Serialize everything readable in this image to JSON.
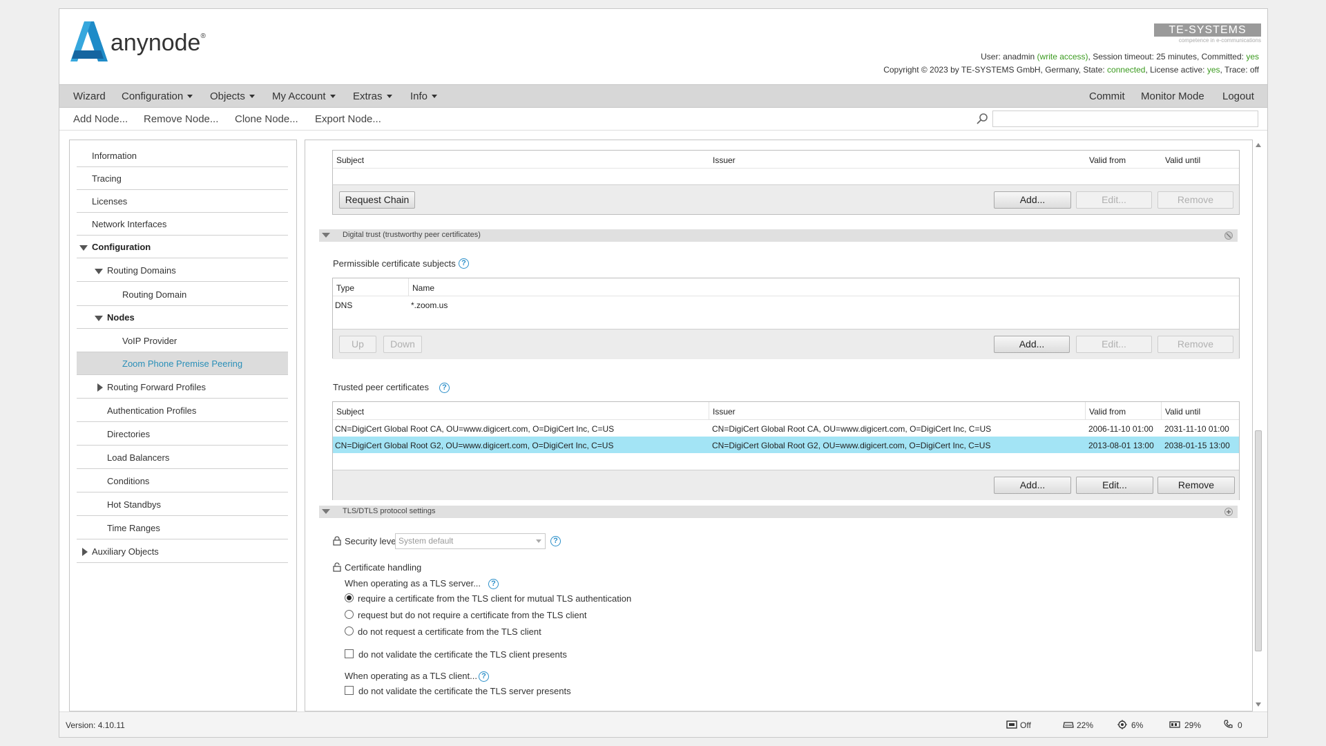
{
  "app": {
    "name": "anynode",
    "trademark": "®",
    "vendor": "TE-SYSTEMS",
    "vendor_tagline": "competence in e-communications"
  },
  "header": {
    "line1": {
      "user_prefix": "User: ",
      "user": "anadmin",
      "access": "(write access)",
      "session": ", Session timeout: 25 minutes, Committed: ",
      "committed": "yes"
    },
    "line2": {
      "copyright": "Copyright © 2023 by TE-SYSTEMS GmbH, Germany, State: ",
      "state": "connected",
      "license_prefix": ", License active: ",
      "license": "yes",
      "trace": ", Trace: off"
    }
  },
  "menu": {
    "left": [
      "Wizard",
      "Configuration",
      "Objects",
      "My Account",
      "Extras",
      "Info"
    ],
    "right": [
      "Commit",
      "Monitor Mode",
      "Logout"
    ]
  },
  "toolbar": {
    "actions": [
      "Add Node...",
      "Remove Node...",
      "Clone Node...",
      "Export Node..."
    ],
    "search_placeholder": ""
  },
  "sidebar": {
    "items": [
      {
        "label": "Information"
      },
      {
        "label": "Tracing"
      },
      {
        "label": "Licenses"
      },
      {
        "label": "Network Interfaces"
      },
      {
        "label": "Configuration"
      },
      {
        "label": "Routing Domains"
      },
      {
        "label": "Routing Domain"
      },
      {
        "label": "Nodes"
      },
      {
        "label": "VoIP Provider"
      },
      {
        "label": "Zoom Phone Premise Peering"
      },
      {
        "label": "Routing Forward Profiles"
      },
      {
        "label": "Authentication Profiles"
      },
      {
        "label": "Directories"
      },
      {
        "label": "Load Balancers"
      },
      {
        "label": "Conditions"
      },
      {
        "label": "Hot Standbys"
      },
      {
        "label": "Time Ranges"
      },
      {
        "label": "Auxiliary Objects"
      }
    ]
  },
  "chain_table": {
    "columns": [
      "Subject",
      "Issuer",
      "Valid from",
      "Valid until"
    ],
    "request_chain": "Request Chain",
    "add": "Add...",
    "edit": "Edit...",
    "remove": "Remove"
  },
  "digital_trust": {
    "title": "Digital trust (trustworthy peer certificates)",
    "subjects_label": "Permissible certificate subjects",
    "subjects_columns": [
      "Type",
      "Name"
    ],
    "subjects_rows": [
      {
        "type": "DNS",
        "name": "*.zoom.us"
      }
    ],
    "up": "Up",
    "down": "Down",
    "add": "Add...",
    "edit": "Edit...",
    "remove": "Remove",
    "trusted_label": "Trusted peer certificates",
    "trusted_columns": [
      "Subject",
      "Issuer",
      "Valid from",
      "Valid until"
    ],
    "trusted_rows": [
      {
        "subject": "CN=DigiCert Global Root CA, OU=www.digicert.com, O=DigiCert Inc, C=US",
        "issuer": "CN=DigiCert Global Root CA, OU=www.digicert.com, O=DigiCert Inc, C=US",
        "valid_from": "2006-11-10 01:00",
        "valid_until": "2031-11-10 01:00",
        "selected": false
      },
      {
        "subject": "CN=DigiCert Global Root G2, OU=www.digicert.com, O=DigiCert Inc, C=US",
        "issuer": "CN=DigiCert Global Root G2, OU=www.digicert.com, O=DigiCert Inc, C=US",
        "valid_from": "2013-08-01 13:00",
        "valid_until": "2038-01-15 13:00",
        "selected": true
      }
    ],
    "trusted_add": "Add...",
    "trusted_edit": "Edit...",
    "trusted_remove": "Remove"
  },
  "tls": {
    "title": "TLS/DTLS protocol settings",
    "security_level_label": "Security level",
    "security_level_value": "System default",
    "cert_handling_label": "Certificate handling",
    "server_label": "When operating as a TLS server...",
    "server_options": [
      {
        "label": "require a certificate from the TLS client for mutual TLS authentication",
        "selected": true
      },
      {
        "label": "request but do not require a certificate from the TLS client",
        "selected": false
      },
      {
        "label": "do not request a certificate from the TLS client",
        "selected": false
      }
    ],
    "no_validate_client": "do not validate the certificate the TLS client presents",
    "client_label": "When operating as a TLS client...",
    "no_validate_server": "do not validate the certificate the TLS server presents"
  },
  "statusbar": {
    "version": "Version: 4.10.11",
    "items": [
      {
        "icon": "recording-icon",
        "value": "Off"
      },
      {
        "icon": "disk-icon",
        "value": "22%"
      },
      {
        "icon": "cpu-icon",
        "value": "6%"
      },
      {
        "icon": "memory-icon",
        "value": "29%"
      },
      {
        "icon": "calls-icon",
        "value": "0"
      }
    ]
  },
  "colors": {
    "accent": "#2a8fb8",
    "selected_row": "#a3e4f5",
    "green": "#3a9a1e",
    "logo_blue": "#1e8bc8"
  }
}
